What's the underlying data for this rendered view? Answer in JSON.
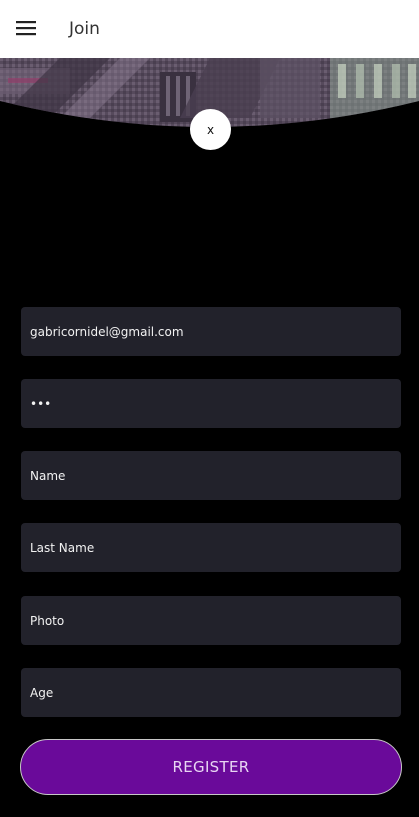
{
  "app_bar": {
    "title": "Join",
    "menu_icon": "hamburger-menu-icon"
  },
  "close_button": {
    "label": "x"
  },
  "form": {
    "email": "gabricornidel@gmail.com",
    "password_mask": "•••",
    "name_placeholder": "Name",
    "last_name_placeholder": "Last Name",
    "photo_placeholder": "Photo",
    "age_placeholder": "Age"
  },
  "register_button": {
    "label": "REGISTER"
  },
  "colors": {
    "background": "#000000",
    "field_bg": "#22222b",
    "accent": "#6a0a9a",
    "button_text": "#e8d6f3",
    "appbar_bg": "#ffffff"
  }
}
